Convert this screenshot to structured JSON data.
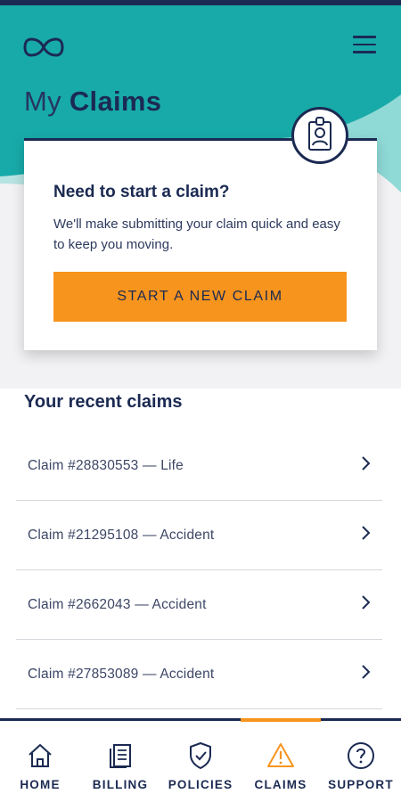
{
  "header": {
    "title_light": "My",
    "title_bold": "Claims"
  },
  "card": {
    "title": "Need to start a claim?",
    "description": "We'll make submitting your claim quick and easy to keep you moving.",
    "cta_label": "START A NEW CLAIM"
  },
  "recent": {
    "title": "Your recent claims",
    "claims": [
      {
        "label": "Claim #28830553 — Life"
      },
      {
        "label": "Claim #21295108 — Accident"
      },
      {
        "label": "Claim #2662043 — Accident"
      },
      {
        "label": "Claim #27853089 — Accident"
      }
    ]
  },
  "nav": {
    "items": [
      {
        "label": "HOME",
        "icon": "home-icon"
      },
      {
        "label": "BILLING",
        "icon": "billing-icon"
      },
      {
        "label": "POLICIES",
        "icon": "shield-icon"
      },
      {
        "label": "CLAIMS",
        "icon": "warning-icon",
        "active": true
      },
      {
        "label": "SUPPORT",
        "icon": "help-icon"
      }
    ]
  },
  "colors": {
    "navy": "#1b2a52",
    "teal": "#18aaa8",
    "light_teal": "#8fd9d6",
    "orange": "#f7941d",
    "background": "#f2f2f4"
  }
}
